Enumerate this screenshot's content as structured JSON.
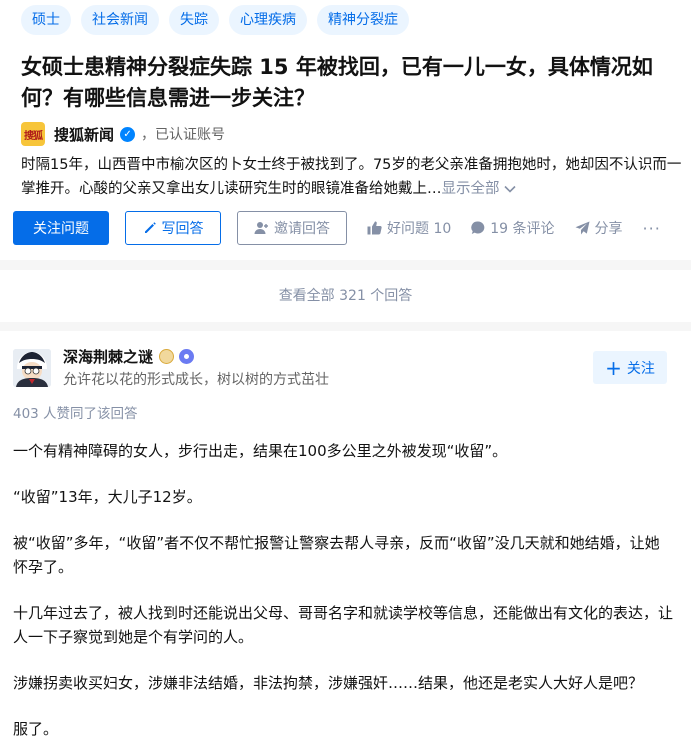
{
  "topics": [
    "硕士",
    "社会新闻",
    "失踪",
    "心理疾病",
    "精神分裂症"
  ],
  "question": {
    "title": "女硕士患精神分裂症失踪 15 年被找回，已有一儿一女，具体情况如何？有哪些信息需进一步关注？",
    "author": {
      "logo_text": "搜狐",
      "name": "搜狐新闻",
      "verify_text": "，已认证账号"
    },
    "excerpt": "时隔15年，山西晋中市榆次区的卜女士终于被找到了。75岁的老父亲准备拥抱她时，她却因不认识而一掌推开。心酸的父亲又拿出女儿读研究生时的眼镜准备给她戴上…",
    "show_all": "显示全部",
    "actions": {
      "follow": "关注问题",
      "write": "写回答",
      "invite": "邀请回答",
      "good": "好问题 10",
      "comments": "19 条评论",
      "share": "分享",
      "more": "···"
    }
  },
  "view_all": "查看全部 321 个回答",
  "answer": {
    "author_name": "深海荆棘之谜",
    "bio": "允许花以花的形式成长，树以树的方式茁壮",
    "follow": "关注",
    "follow_icon": "+",
    "vote_summary": "403 人赞同了该回答",
    "paragraphs": [
      "一个有精神障碍的女人，步行出走，结果在100多公里之外被发现“收留”。",
      "“收留”13年，大儿子12岁。",
      "被“收留”多年，“收留”者不仅不帮忙报警让警察去帮人寻亲，反而“收留”没几天就和她结婚，让她怀孕了。",
      "十几年过去了，被人找到时还能说出父母、哥哥名字和就读学校等信息，还能做出有文化的表达，让人一下子察觉到她是个有学问的人。",
      "涉嫌拐卖收买妇女，涉嫌非法结婚，非法拘禁，涉嫌强奸……结果，他还是老实人大好人是吧？",
      "服了。"
    ]
  },
  "colors": {
    "brand": "#056de8",
    "meta": "#8590a6",
    "topic_bg": "#ebf5ff"
  }
}
